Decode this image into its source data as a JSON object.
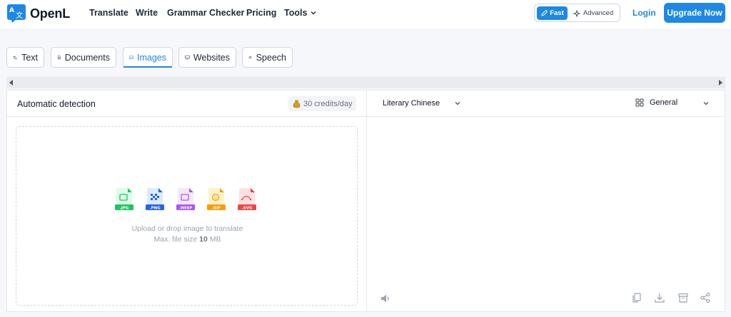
{
  "header": {
    "logo_text": "OpenL",
    "nav": [
      "Translate",
      "Write",
      "Grammar Checker",
      "Pricing",
      "Tools"
    ],
    "mode_fast": "Fast",
    "mode_advanced": "Advanced",
    "login": "Login",
    "upgrade": "Upgrade Now"
  },
  "tabs": [
    {
      "label": "Text",
      "icon": "translate-icon"
    },
    {
      "label": "Documents",
      "icon": "document-icon"
    },
    {
      "label": "Images",
      "icon": "image-icon",
      "active": true
    },
    {
      "label": "Websites",
      "icon": "monitor-icon"
    },
    {
      "label": "Speech",
      "icon": "speaker-icon"
    }
  ],
  "source": {
    "language": "Automatic detection",
    "credits": "30 credits/day"
  },
  "target": {
    "language": "Literary Chinese",
    "domain": "General"
  },
  "dropzone": {
    "file_types": [
      ".JPG",
      ".PNG",
      ".WEBP",
      ".GIF",
      ".SVG"
    ],
    "line1": "Upload or drop image to translate",
    "line2_prefix": "Max. file size ",
    "line2_size": "10",
    "line2_unit": " MB"
  },
  "colors": {
    "accent": "#1e88e5",
    "jpg": "#22c55e",
    "png": "#2563eb",
    "webp": "#a855f7",
    "gif": "#f59e0b",
    "svg": "#ef4444"
  }
}
